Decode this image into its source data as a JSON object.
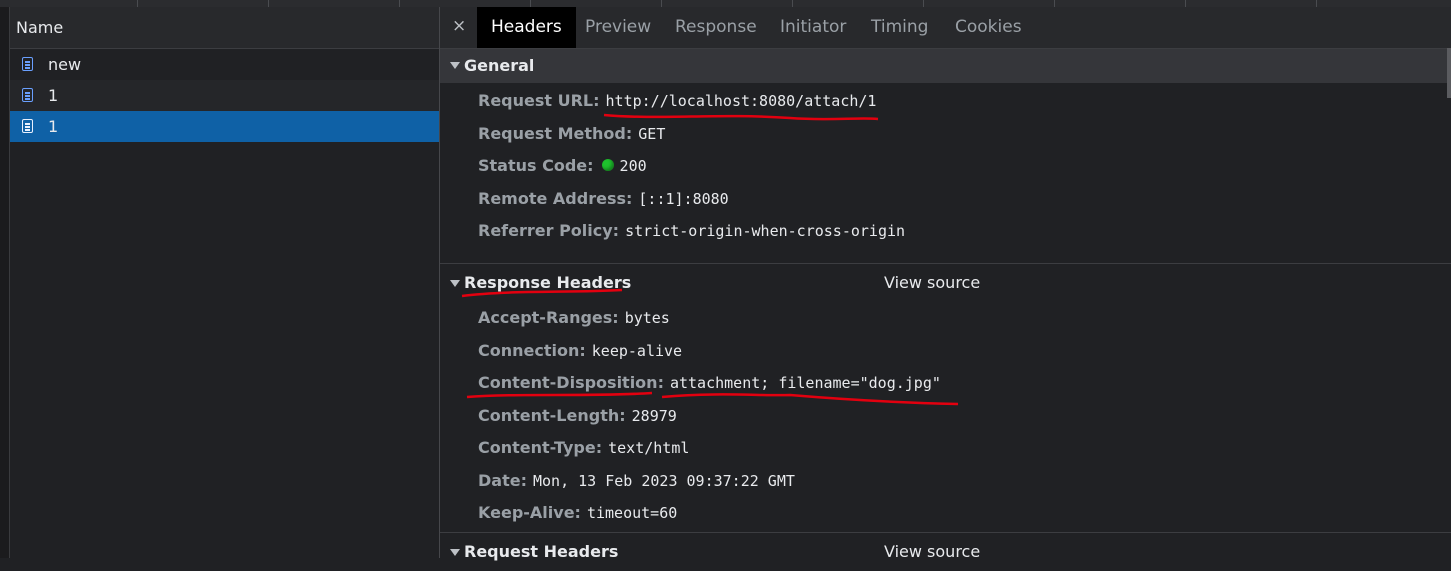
{
  "left_panel": {
    "column_header": "Name",
    "requests": [
      {
        "name": "new",
        "selected": false
      },
      {
        "name": "1",
        "selected": false
      },
      {
        "name": "1",
        "selected": true
      }
    ]
  },
  "tabs": {
    "close_glyph": "×",
    "items": [
      "Headers",
      "Preview",
      "Response",
      "Initiator",
      "Timing",
      "Cookies"
    ],
    "active": "Headers"
  },
  "general": {
    "title": "General",
    "rows": [
      {
        "key": "Request URL:",
        "value": "http://localhost:8080/attach/1"
      },
      {
        "key": "Request Method:",
        "value": "GET"
      },
      {
        "key": "Status Code:",
        "value": "200"
      },
      {
        "key": "Remote Address:",
        "value": "[::1]:8080"
      },
      {
        "key": "Referrer Policy:",
        "value": "strict-origin-when-cross-origin"
      }
    ]
  },
  "response_headers": {
    "title": "Response Headers",
    "view_source": "View source",
    "rows": [
      {
        "key": "Accept-Ranges:",
        "value": "bytes"
      },
      {
        "key": "Connection:",
        "value": "keep-alive"
      },
      {
        "key": "Content-Disposition:",
        "value": "attachment; filename=\"dog.jpg\""
      },
      {
        "key": "Content-Length:",
        "value": "28979"
      },
      {
        "key": "Content-Type:",
        "value": "text/html"
      },
      {
        "key": "Date:",
        "value": "Mon, 13 Feb 2023 09:37:22 GMT"
      },
      {
        "key": "Keep-Alive:",
        "value": "timeout=60"
      }
    ]
  },
  "request_headers": {
    "title": "Request Headers",
    "view_source": "View source"
  },
  "colors": {
    "selected_row": "#0f61a6",
    "status_ok": "#1ec22d",
    "annotation": "#e3000f"
  }
}
